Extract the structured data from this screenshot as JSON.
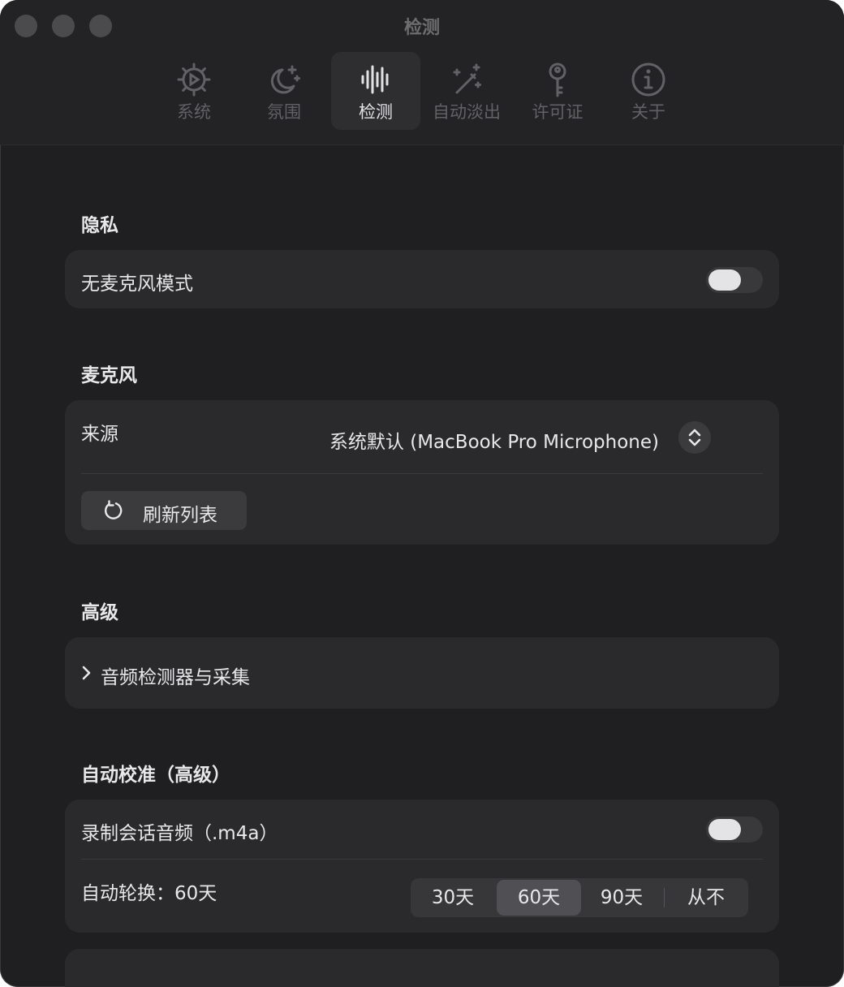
{
  "window": {
    "title": "检测"
  },
  "tabs": [
    {
      "label": "系统",
      "icon": "gear-icon"
    },
    {
      "label": "氛围",
      "icon": "moon-stars-icon"
    },
    {
      "label": "检测",
      "icon": "waveform-icon",
      "active": true
    },
    {
      "label": "自动淡出",
      "icon": "magic-wand-icon"
    },
    {
      "label": "许可证",
      "icon": "key-icon"
    },
    {
      "label": "关于",
      "icon": "info-icon"
    }
  ],
  "privacy": {
    "title": "隐私",
    "no_mic_label": "无麦克风模式",
    "no_mic_on": false
  },
  "microphone": {
    "title": "麦克风",
    "source_label": "来源",
    "source_value": "系统默认 (MacBook Pro Microphone)",
    "refresh_label": "刷新列表"
  },
  "advanced": {
    "title": "高级",
    "disclosure_label": "音频检测器与采集"
  },
  "calibration": {
    "title": "自动校准（高级）",
    "record_label": "录制会话音频（.m4a）",
    "record_on": false,
    "rotation_label": "自动轮换：60天",
    "options": [
      "30天",
      "60天",
      "90天",
      "从不"
    ],
    "selected_index": 1
  },
  "colors": {
    "window_bg": "#1f1f21",
    "card_bg": "#2a2a2d",
    "text": "#e8e8ea",
    "muted": "#626266"
  }
}
